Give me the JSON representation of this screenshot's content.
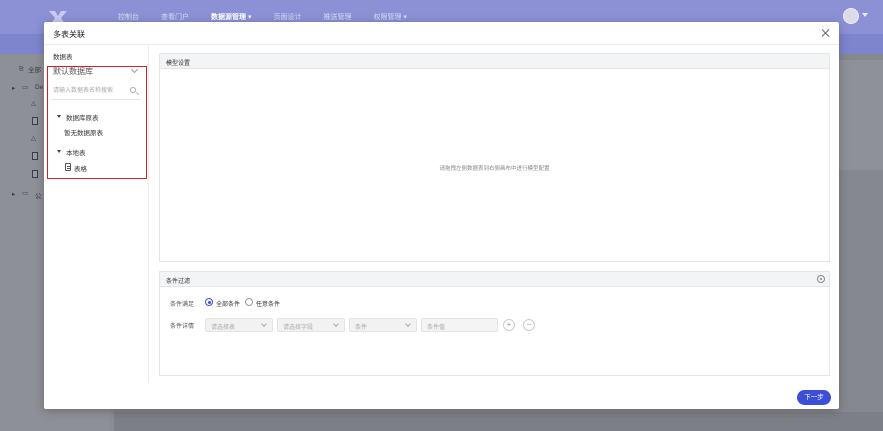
{
  "background": {
    "nav": [
      "控制台",
      "查看门户",
      "数据源管理 ▾",
      "页面设计",
      "推送管理",
      "权限管理 ▾"
    ],
    "active_nav_index": 2,
    "sidebar": {
      "all_label": "全部",
      "tree_root": "De",
      "public_label": "公"
    }
  },
  "modal": {
    "title": "多表关联",
    "left_pane": {
      "title": "数据表",
      "database_select": "默认数据库",
      "search_placeholder": "请输入数据表名称搜索",
      "groups": [
        {
          "label": "数据库原表",
          "empty_text": "暂无数据原表",
          "items": []
        },
        {
          "label": "本地表",
          "items": [
            "表格"
          ]
        }
      ]
    },
    "model_panel": {
      "title": "模型设置",
      "hint": "请拖拽左侧数据表到右侧画布中进行模型配置"
    },
    "filter_panel": {
      "title": "条件过滤",
      "match_label": "条件满足",
      "match_options": [
        "全部条件",
        "任意条件"
      ],
      "match_selected": 0,
      "detail_label": "条件详情",
      "selects": [
        "请选择表",
        "请选择字段",
        "条件"
      ],
      "value_placeholder": "条件值",
      "add_symbol": "+",
      "remove_symbol": "−"
    },
    "next_button": "下一步"
  },
  "colors": {
    "accent": "#3b4fd9",
    "highlight": "#d91e1e"
  }
}
